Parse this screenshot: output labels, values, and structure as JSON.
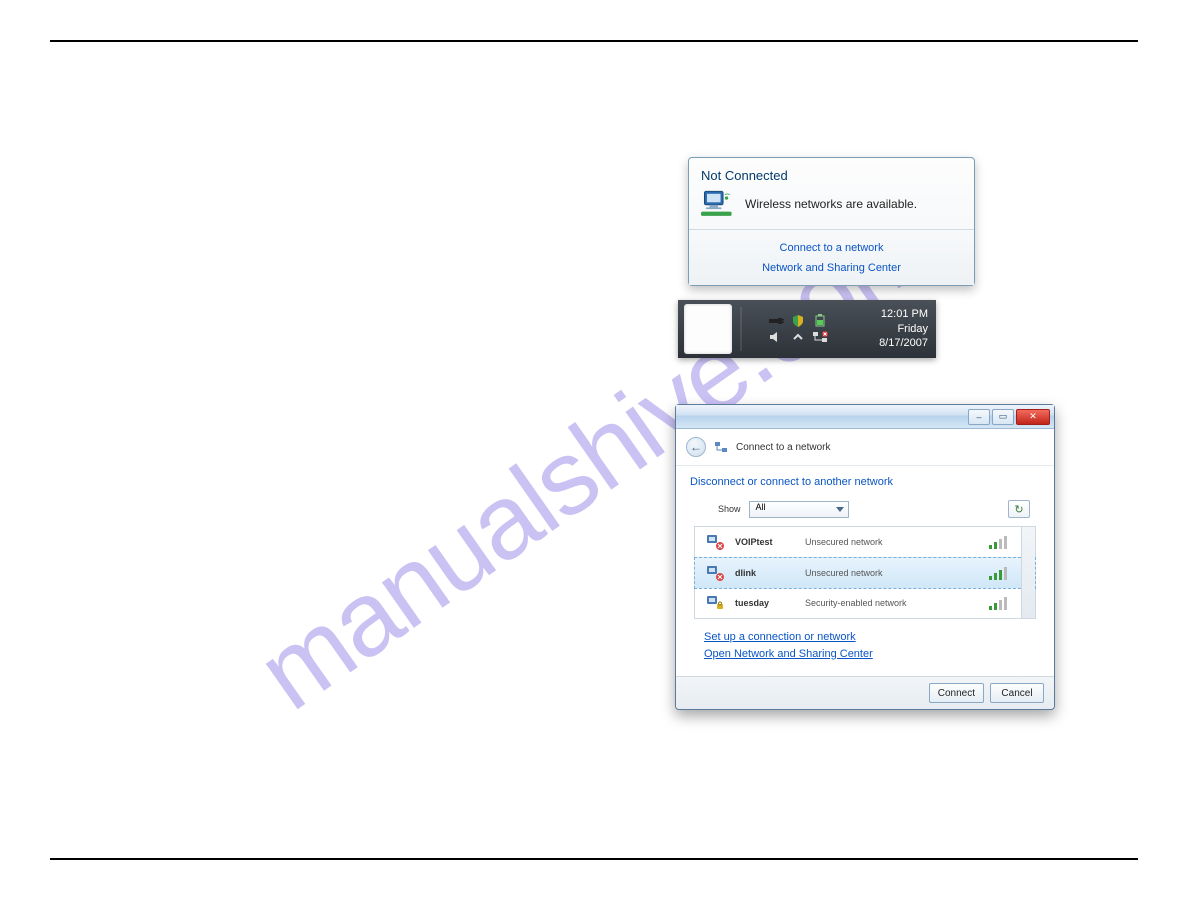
{
  "watermark": "manualshive.com",
  "popup": {
    "title": "Not Connected",
    "message": "Wireless networks are available.",
    "links": {
      "connect": "Connect to a network",
      "center": "Network and Sharing Center"
    }
  },
  "taskbar": {
    "time": "12:01 PM",
    "day": "Friday",
    "date": "8/17/2007"
  },
  "window": {
    "nav_title": "Connect to a network",
    "body_title": "Disconnect or connect to another network",
    "show_label": "Show",
    "show_value": "All",
    "networks": [
      {
        "name": "VOIPtest",
        "security": "Unsecured network",
        "signal": 2,
        "selected": false
      },
      {
        "name": "dlink",
        "security": "Unsecured network",
        "signal": 3,
        "selected": true
      },
      {
        "name": "tuesday",
        "security": "Security-enabled network",
        "signal": 2,
        "selected": false
      }
    ],
    "links": {
      "setup": "Set up a connection or network",
      "open_center": "Open Network and Sharing Center"
    },
    "buttons": {
      "connect": "Connect",
      "cancel": "Cancel"
    }
  }
}
